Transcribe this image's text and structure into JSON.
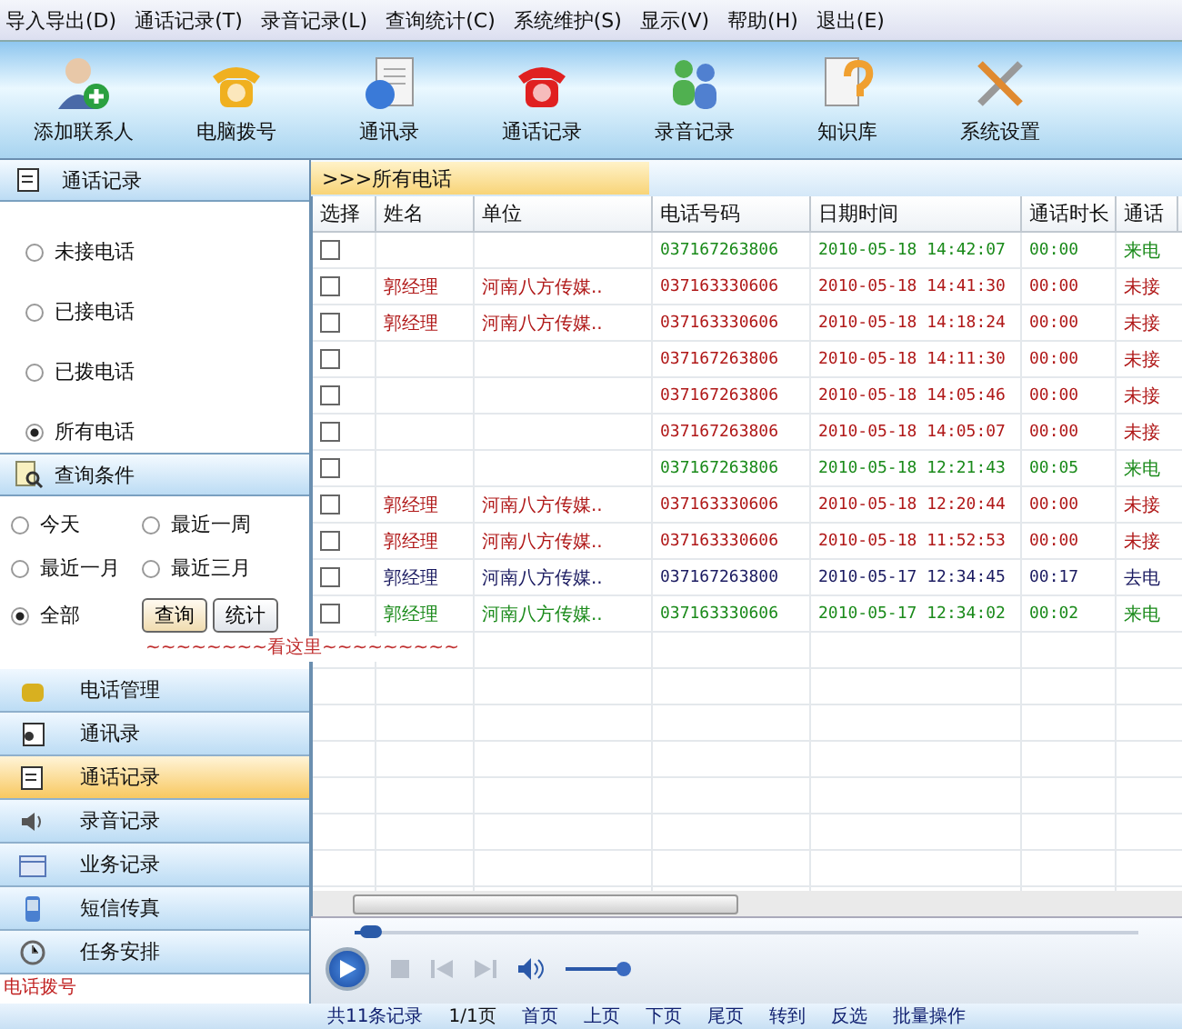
{
  "menu": [
    "导入导出(D)",
    "通话记录(T)",
    "录音记录(L)",
    "查询统计(C)",
    "系统维护(S)",
    "显示(V)",
    "帮助(H)",
    "退出(E)"
  ],
  "toolbar": [
    {
      "kind": "contact",
      "label": "添加联系人"
    },
    {
      "kind": "dial",
      "label": "电脑拨号"
    },
    {
      "kind": "book",
      "label": "通讯录"
    },
    {
      "kind": "calls",
      "label": "通话记录"
    },
    {
      "kind": "record",
      "label": "录音记录"
    },
    {
      "kind": "knowledge",
      "label": "知识库"
    },
    {
      "kind": "settings",
      "label": "系统设置"
    }
  ],
  "call_panel": {
    "title": "通话记录",
    "filters": [
      {
        "label": "未接电话",
        "selected": false
      },
      {
        "label": "已接电话",
        "selected": false
      },
      {
        "label": "已拨电话",
        "selected": false
      },
      {
        "label": "所有电话",
        "selected": true
      }
    ]
  },
  "query_panel": {
    "title": "查询条件",
    "ranges": [
      {
        "label": "今天",
        "selected": false
      },
      {
        "label": "最近一周",
        "selected": false
      },
      {
        "label": "最近一月",
        "selected": false
      },
      {
        "label": "最近三月",
        "selected": false
      },
      {
        "label": "全部",
        "selected": true
      }
    ],
    "buttons": [
      "查询",
      "统计"
    ],
    "note": "~~~~~~~~看这里~~~~~~~~~"
  },
  "nav": [
    {
      "kind": "phone",
      "label": "电话管理",
      "selected": false
    },
    {
      "kind": "book",
      "label": "通讯录",
      "selected": false
    },
    {
      "kind": "calls",
      "label": "通话记录",
      "selected": true
    },
    {
      "kind": "sound",
      "label": "录音记录",
      "selected": false
    },
    {
      "kind": "calendar",
      "label": "业务记录",
      "selected": false
    },
    {
      "kind": "mobile",
      "label": "短信传真",
      "selected": false
    },
    {
      "kind": "clock",
      "label": "任务安排",
      "selected": false
    }
  ],
  "left_footer": "电话拨号",
  "breadcrumb": ">>>所有电话",
  "table": {
    "columns": [
      "选择",
      "姓名",
      "单位",
      "电话号码",
      "日期时间",
      "通话时长",
      "通话"
    ],
    "rows": [
      {
        "kind": "incoming",
        "checked": false,
        "name": "",
        "unit": "",
        "phone": "037167263806",
        "time": "2010-05-18 14:42:07",
        "duration": "00:00",
        "type": "来电"
      },
      {
        "kind": "missed",
        "checked": false,
        "name": "郭经理",
        "unit": "河南八方传媒..",
        "phone": "037163330606",
        "time": "2010-05-18 14:41:30",
        "duration": "00:00",
        "type": "未接"
      },
      {
        "kind": "missed",
        "checked": false,
        "name": "郭经理",
        "unit": "河南八方传媒..",
        "phone": "037163330606",
        "time": "2010-05-18 14:18:24",
        "duration": "00:00",
        "type": "未接"
      },
      {
        "kind": "missed",
        "checked": false,
        "name": "",
        "unit": "",
        "phone": "037167263806",
        "time": "2010-05-18 14:11:30",
        "duration": "00:00",
        "type": "未接"
      },
      {
        "kind": "missed",
        "checked": false,
        "name": "",
        "unit": "",
        "phone": "037167263806",
        "time": "2010-05-18 14:05:46",
        "duration": "00:00",
        "type": "未接"
      },
      {
        "kind": "missed",
        "checked": false,
        "name": "",
        "unit": "",
        "phone": "037167263806",
        "time": "2010-05-18 14:05:07",
        "duration": "00:00",
        "type": "未接"
      },
      {
        "kind": "incoming",
        "checked": false,
        "name": "",
        "unit": "",
        "phone": "037167263806",
        "time": "2010-05-18 12:21:43",
        "duration": "00:05",
        "type": "来电"
      },
      {
        "kind": "missed",
        "checked": false,
        "name": "郭经理",
        "unit": "河南八方传媒..",
        "phone": "037163330606",
        "time": "2010-05-18 12:20:44",
        "duration": "00:00",
        "type": "未接"
      },
      {
        "kind": "missed",
        "checked": false,
        "name": "郭经理",
        "unit": "河南八方传媒..",
        "phone": "037163330606",
        "time": "2010-05-18 11:52:53",
        "duration": "00:00",
        "type": "未接"
      },
      {
        "kind": "outgoing",
        "checked": false,
        "name": "郭经理",
        "unit": "河南八方传媒..",
        "phone": "037167263800",
        "time": "2010-05-17 12:34:45",
        "duration": "00:17",
        "type": "去电"
      },
      {
        "kind": "incoming",
        "checked": false,
        "name": "郭经理",
        "unit": "河南八方传媒..",
        "phone": "037163330606",
        "time": "2010-05-17 12:34:02",
        "duration": "00:02",
        "type": "来电"
      }
    ]
  },
  "player": {
    "seek": {
      "level": 0.02
    },
    "volume": {
      "level": 0.55
    }
  },
  "status_bar": [
    "共11条记录",
    "1/1页",
    "首页",
    "上页",
    "下页",
    "尾页",
    "转到",
    "反选",
    "批量操作"
  ]
}
